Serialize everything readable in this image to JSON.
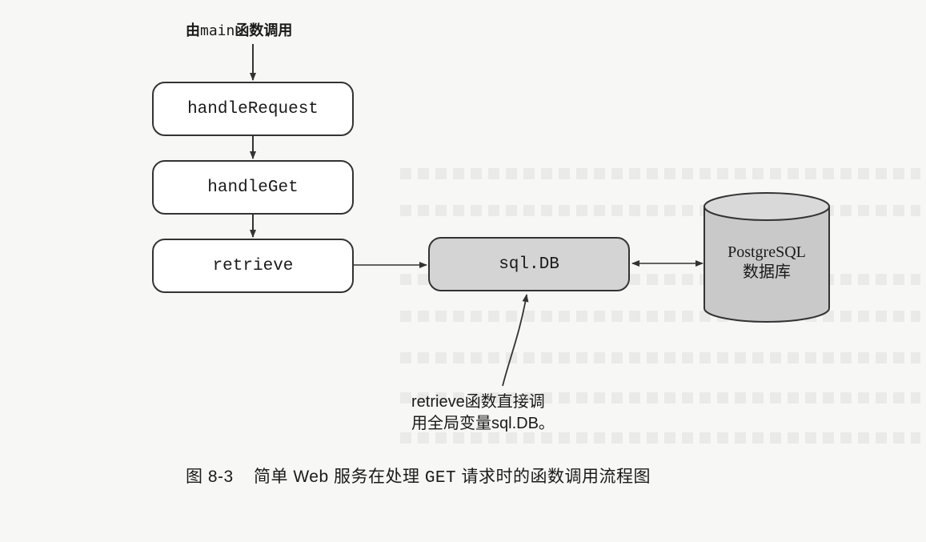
{
  "diagram": {
    "entry_label_prefix": "由",
    "entry_label_code": "main",
    "entry_label_suffix": "函数调用",
    "functions": [
      "handleRequest",
      "handleGet",
      "retrieve"
    ],
    "driver": "sql.DB",
    "database_name": "PostgreSQL",
    "database_desc": "数据库",
    "note_line1": "retrieve函数直接调",
    "note_line2": "用全局变量sql.DB。"
  },
  "caption": {
    "prefix": "图 8-3    简单 Web 服务在处理 ",
    "code": "GET",
    "suffix": " 请求时的函数调用流程图"
  },
  "colors": {
    "stroke": "#333333",
    "driver_fill": "#d4d4d4",
    "cylinder_fill": "#c9c9c9"
  }
}
